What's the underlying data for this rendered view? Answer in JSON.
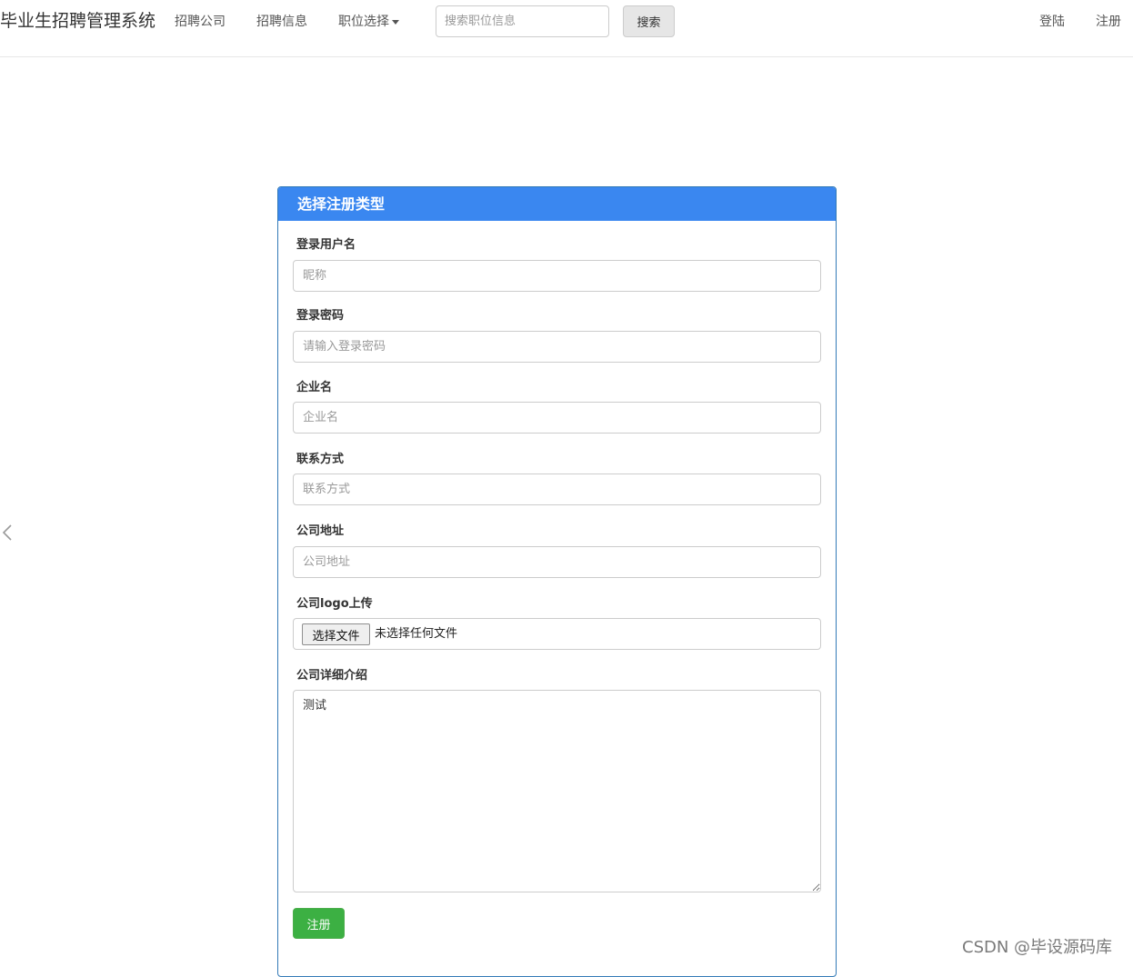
{
  "navbar": {
    "brand": "毕业生招聘管理系统",
    "links": {
      "company": "招聘公司",
      "jobs": "招聘信息",
      "position": "职位选择"
    },
    "search": {
      "placeholder": "搜索职位信息",
      "value": "",
      "button_label": "搜索"
    },
    "login": "登陆",
    "register": "注册"
  },
  "panel": {
    "title": "选择注册类型",
    "fields": [
      {
        "label": "登录用户名",
        "placeholder": "昵称",
        "value": ""
      },
      {
        "label": "登录密码",
        "placeholder": "请输入登录密码",
        "value": ""
      },
      {
        "label": "企业名",
        "placeholder": "企业名",
        "value": ""
      },
      {
        "label": "联系方式",
        "placeholder": "联系方式",
        "value": ""
      },
      {
        "label": "公司地址",
        "placeholder": "公司地址",
        "value": ""
      }
    ],
    "logo": {
      "label": "公司logo上传",
      "button_label": "选择文件",
      "status": "未选择任何文件"
    },
    "detail": {
      "label": "公司详细介绍",
      "value": "测试"
    },
    "submit_label": "注册"
  },
  "watermark": "CSDN @毕设源码库",
  "colors": {
    "panel_heading": "#3a87f0",
    "panel_border": "#337ab7",
    "submit_button": "#3cb043"
  },
  "icons": {
    "left_arrow": "chevron-left-icon",
    "position_caret": "caret-down-icon"
  }
}
